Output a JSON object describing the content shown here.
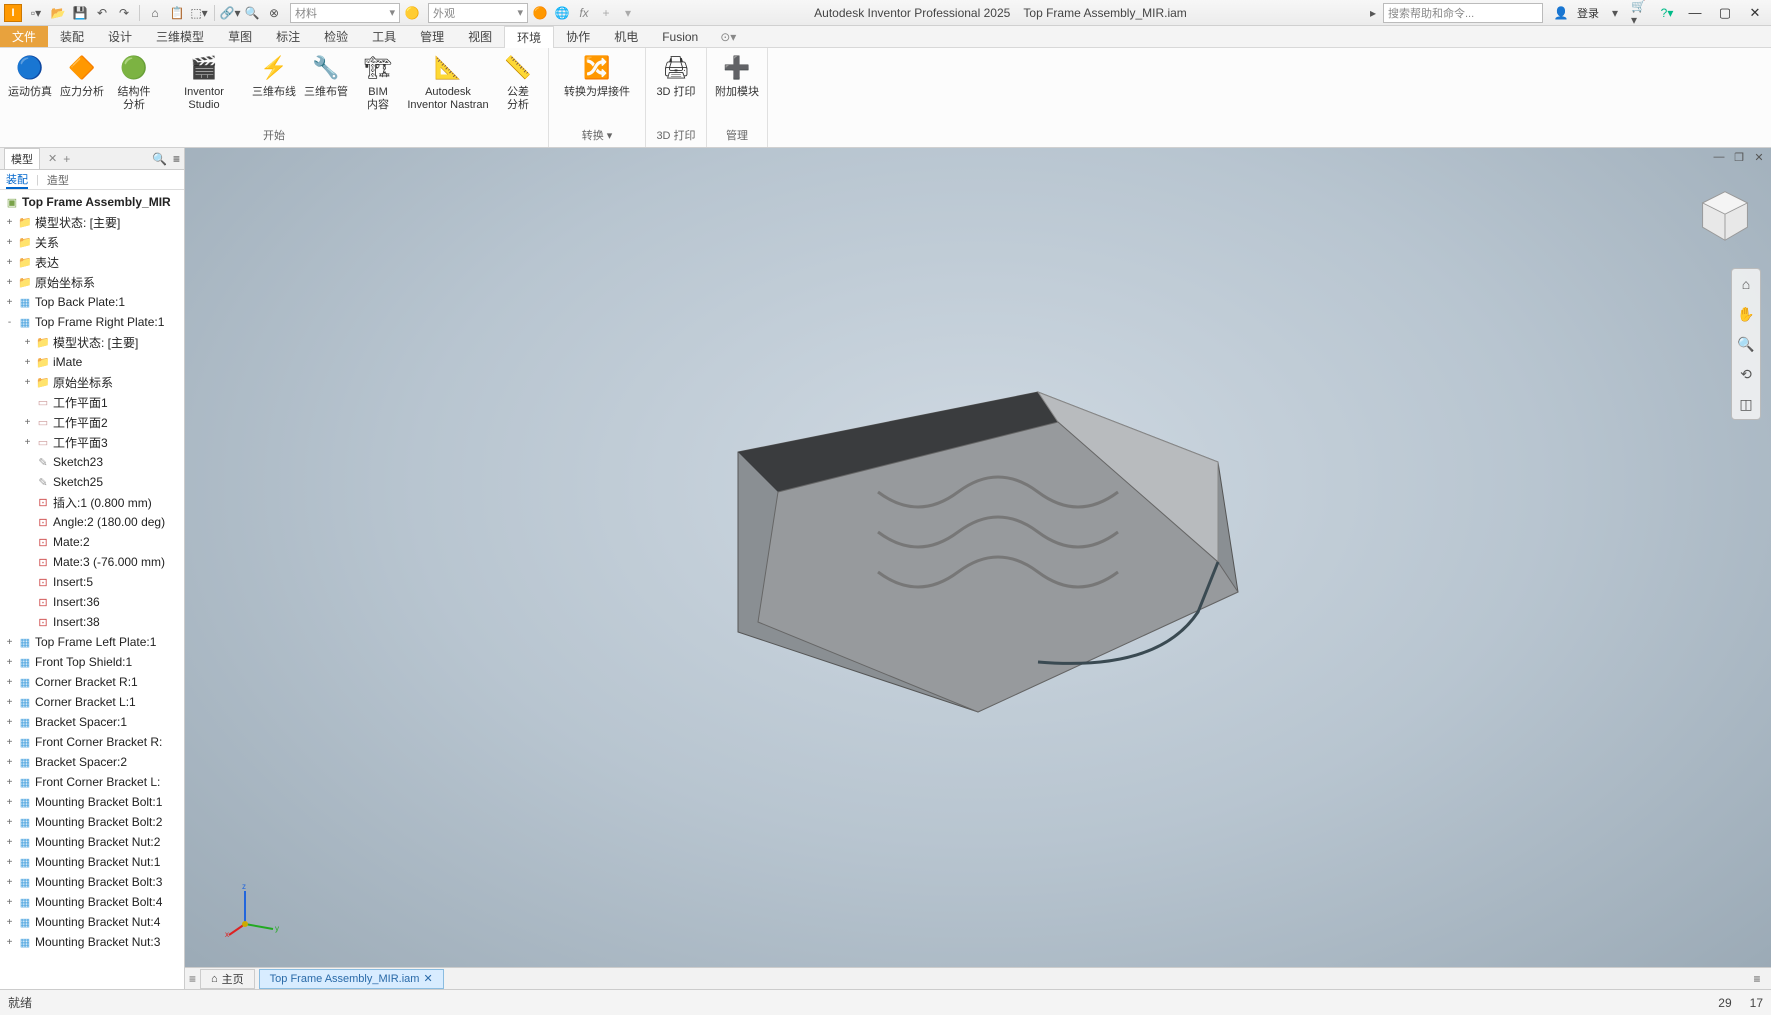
{
  "title": {
    "app": "Autodesk Inventor Professional 2025",
    "doc": "Top Frame Assembly_MIR.iam"
  },
  "qat": {
    "material_placeholder": "材料",
    "appearance_placeholder": "外观"
  },
  "search_placeholder": "搜索帮助和命令...",
  "login": "登录",
  "menu": {
    "file": "文件",
    "tabs": [
      "装配",
      "设计",
      "三维模型",
      "草图",
      "标注",
      "检验",
      "工具",
      "管理",
      "视图",
      "环境",
      "协作",
      "机电",
      "Fusion"
    ],
    "active": "环境"
  },
  "ribbon": {
    "groups": [
      {
        "name": "开始",
        "buttons": [
          {
            "label": "运动仿真"
          },
          {
            "label": "应力分析"
          },
          {
            "label": "结构件\n分析"
          },
          {
            "label": "Inventor\nStudio",
            "wide": true
          },
          {
            "label": "三维布线"
          },
          {
            "label": "三维布管"
          },
          {
            "label": "BIM\n内容"
          },
          {
            "label": "Autodesk Inventor Nastran",
            "wide": true
          },
          {
            "label": "公差\n分析"
          }
        ]
      },
      {
        "name": "转换 ▾",
        "buttons": [
          {
            "label": "转换为焊接件",
            "wide": true
          }
        ]
      },
      {
        "name": "3D 打印",
        "buttons": [
          {
            "label": "3D 打印"
          }
        ]
      },
      {
        "name": "管理",
        "buttons": [
          {
            "label": "附加模块"
          }
        ]
      }
    ]
  },
  "browser": {
    "tab_model": "模型",
    "subtab_assembly": "装配",
    "subtab_modeling": "造型",
    "root": "Top Frame Assembly_MIR",
    "nodes": [
      {
        "d": 0,
        "tw": "+",
        "ic": "folder",
        "t": "模型状态: [主要]"
      },
      {
        "d": 0,
        "tw": "+",
        "ic": "folder",
        "t": "关系"
      },
      {
        "d": 0,
        "tw": "+",
        "ic": "folder",
        "t": "表达"
      },
      {
        "d": 0,
        "tw": "+",
        "ic": "folder",
        "t": "原始坐标系"
      },
      {
        "d": 0,
        "tw": "+",
        "ic": "part",
        "t": "Top Back Plate:1"
      },
      {
        "d": 0,
        "tw": "-",
        "ic": "part",
        "t": "Top Frame Right Plate:1"
      },
      {
        "d": 1,
        "tw": "+",
        "ic": "folder",
        "t": "模型状态: [主要]"
      },
      {
        "d": 1,
        "tw": "+",
        "ic": "folder",
        "t": "iMate"
      },
      {
        "d": 1,
        "tw": "+",
        "ic": "folder",
        "t": "原始坐标系"
      },
      {
        "d": 1,
        "tw": "",
        "ic": "plane",
        "t": "工作平面1"
      },
      {
        "d": 1,
        "tw": "+",
        "ic": "plane",
        "t": "工作平面2"
      },
      {
        "d": 1,
        "tw": "+",
        "ic": "plane",
        "t": "工作平面3"
      },
      {
        "d": 1,
        "tw": "",
        "ic": "sketch",
        "t": "Sketch23"
      },
      {
        "d": 1,
        "tw": "",
        "ic": "sketch",
        "t": "Sketch25"
      },
      {
        "d": 1,
        "tw": "",
        "ic": "constraint",
        "t": "插入:1 (0.800 mm)"
      },
      {
        "d": 1,
        "tw": "",
        "ic": "constraint",
        "t": "Angle:2 (180.00 deg)"
      },
      {
        "d": 1,
        "tw": "",
        "ic": "constraint",
        "t": "Mate:2"
      },
      {
        "d": 1,
        "tw": "",
        "ic": "constraint",
        "t": "Mate:3 (-76.000 mm)"
      },
      {
        "d": 1,
        "tw": "",
        "ic": "constraint",
        "t": "Insert:5"
      },
      {
        "d": 1,
        "tw": "",
        "ic": "constraint",
        "t": "Insert:36"
      },
      {
        "d": 1,
        "tw": "",
        "ic": "constraint",
        "t": "Insert:38"
      },
      {
        "d": 0,
        "tw": "+",
        "ic": "part",
        "t": "Top Frame Left Plate:1"
      },
      {
        "d": 0,
        "tw": "+",
        "ic": "part",
        "t": "Front Top Shield:1"
      },
      {
        "d": 0,
        "tw": "+",
        "ic": "part",
        "t": "Corner Bracket R:1"
      },
      {
        "d": 0,
        "tw": "+",
        "ic": "part",
        "t": "Corner Bracket L:1"
      },
      {
        "d": 0,
        "tw": "+",
        "ic": "part",
        "t": "Bracket Spacer:1"
      },
      {
        "d": 0,
        "tw": "+",
        "ic": "part",
        "t": "Front Corner Bracket R:"
      },
      {
        "d": 0,
        "tw": "+",
        "ic": "part",
        "t": "Bracket Spacer:2"
      },
      {
        "d": 0,
        "tw": "+",
        "ic": "part",
        "t": "Front Corner Bracket L:"
      },
      {
        "d": 0,
        "tw": "+",
        "ic": "part",
        "t": "Mounting Bracket Bolt:1"
      },
      {
        "d": 0,
        "tw": "+",
        "ic": "part",
        "t": "Mounting Bracket Bolt:2"
      },
      {
        "d": 0,
        "tw": "+",
        "ic": "part",
        "t": "Mounting Bracket Nut:2"
      },
      {
        "d": 0,
        "tw": "+",
        "ic": "part",
        "t": "Mounting Bracket Nut:1"
      },
      {
        "d": 0,
        "tw": "+",
        "ic": "part",
        "t": "Mounting Bracket Bolt:3"
      },
      {
        "d": 0,
        "tw": "+",
        "ic": "part",
        "t": "Mounting Bracket Bolt:4"
      },
      {
        "d": 0,
        "tw": "+",
        "ic": "part",
        "t": "Mounting Bracket Nut:4"
      },
      {
        "d": 0,
        "tw": "+",
        "ic": "part",
        "t": "Mounting Bracket Nut:3"
      }
    ]
  },
  "doctabs": {
    "home": "主页",
    "active": "Top Frame Assembly_MIR.iam"
  },
  "status": {
    "left": "就绪",
    "num1": "29",
    "num2": "17"
  }
}
